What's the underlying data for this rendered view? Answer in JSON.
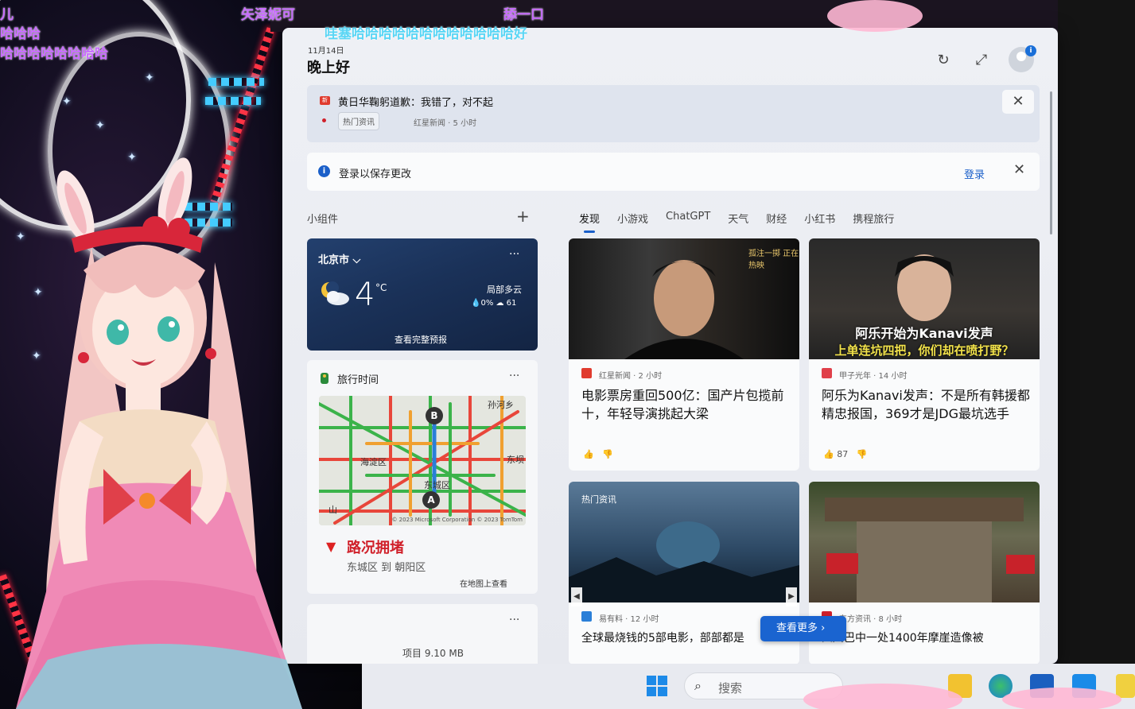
{
  "overlay": {
    "danmaku": [
      {
        "text": "儿"
      },
      {
        "text": "哈哈哈"
      },
      {
        "text": "哈哈哈哈哈哈哈哈"
      },
      {
        "text": "矢泽妮可"
      },
      {
        "text": "舔一口"
      },
      {
        "text": "哇塞哈哈哈哈哈哈哈哈哈哈哈哈好"
      }
    ]
  },
  "header": {
    "date": "11月14日",
    "greeting": "晚上好",
    "refresh_icon": "refresh-icon",
    "expand_icon": "expand-icon",
    "avatar_badge": "i"
  },
  "alert": {
    "title": "黄日华鞠躬道歉：我错了，对不起",
    "tag": "热门资讯",
    "meta": "红星新闻 · 5 小时",
    "close": "✕"
  },
  "signin": {
    "message": "登录以保存更改",
    "action": "登录",
    "close": "✕"
  },
  "widgets": {
    "label": "小组件",
    "add": "+"
  },
  "tabs": [
    "发现",
    "小游戏",
    "ChatGPT",
    "天气",
    "财经",
    "小红书",
    "携程旅行"
  ],
  "weather": {
    "city": "北京市 ⌵",
    "more": "···",
    "temp": "4",
    "unit": "°C",
    "condition": "局部多云",
    "precip": "💧0%  ☁ 61",
    "forecast": "查看完整预报"
  },
  "traffic": {
    "label": "旅行时间",
    "more": "···",
    "places": [
      "孙河乡",
      "海淀区",
      "东坝",
      "东城区",
      "山"
    ],
    "pin_b": "B",
    "pin_a": "A",
    "attribution": "© 2023 Microsoft Corporation © 2023 TomTom",
    "status": "路况拥堵",
    "route": "东城区 到 朝阳区",
    "view_map": "在地图上查看"
  },
  "widget3": {
    "more": "···",
    "partial": "项目 9.10 MB"
  },
  "news": [
    {
      "image_text": "孤注一掷 正在热映",
      "logo_color": "#e03b2e",
      "source": "红星新闻 · 2 小时",
      "headline": "电影票房重回500亿：国产片包揽前十，年轻导演挑起大梁",
      "likes": ""
    },
    {
      "image_caption_1": "阿乐开始为Kanavi发声",
      "image_caption_2": "上单连坑四把，你们却在喷打野？",
      "logo_color": "#e0404a",
      "source": "甲子光年 · 14 小时",
      "headline": "阿乐为Kanavi发声：不是所有韩援都精忠报国，369才是JDG最坑选手",
      "likes": "87"
    },
    {
      "image_tag": "热门资讯",
      "logo_color": "#2a7fd8",
      "source": "易有料 · 12 小时",
      "headline": "全球最烧钱的5部电影，部部都是"
    },
    {
      "logo_color": "#d0202a",
      "source": "东方资讯 · 8 小时",
      "headline": "四川巴中一处1400年摩崖造像被"
    }
  ],
  "more_button": "查看更多 ›",
  "taskbar": {
    "search_placeholder": "搜索"
  }
}
